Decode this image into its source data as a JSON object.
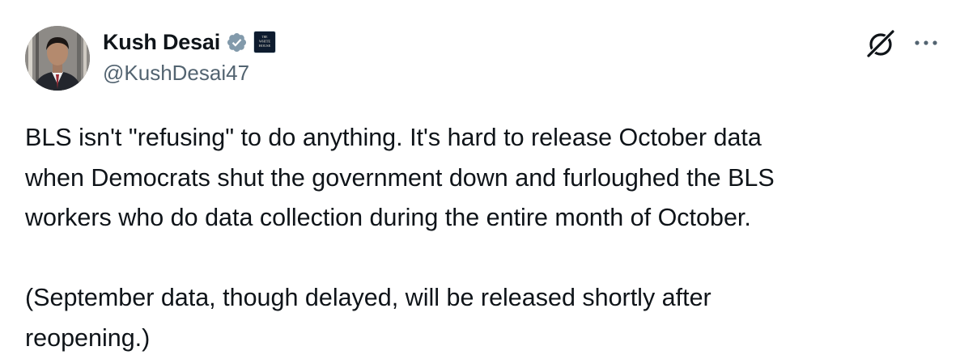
{
  "author": {
    "display_name": "Kush Desai",
    "handle": "@KushDesai47",
    "verified_icon": "verified-badge-icon",
    "affiliate_badge": "white-house-badge",
    "affiliate_badge_text": [
      "THE",
      "WHITE",
      "HOUSE"
    ]
  },
  "actions": {
    "grok_icon": "grok-icon",
    "more_icon": "more-options-icon"
  },
  "tweet": {
    "text": "BLS isn't \"refusing\" to do anything. It's hard to release October data\nwhen Democrats shut the government down and furloughed the BLS\nworkers who do data collection during the entire month of October.\n\n(September data, though delayed, will be released shortly after\nreopening.)"
  },
  "colors": {
    "text_primary": "#0f1419",
    "text_secondary": "#536471",
    "verified_badge": "#829aab",
    "background": "#ffffff"
  }
}
